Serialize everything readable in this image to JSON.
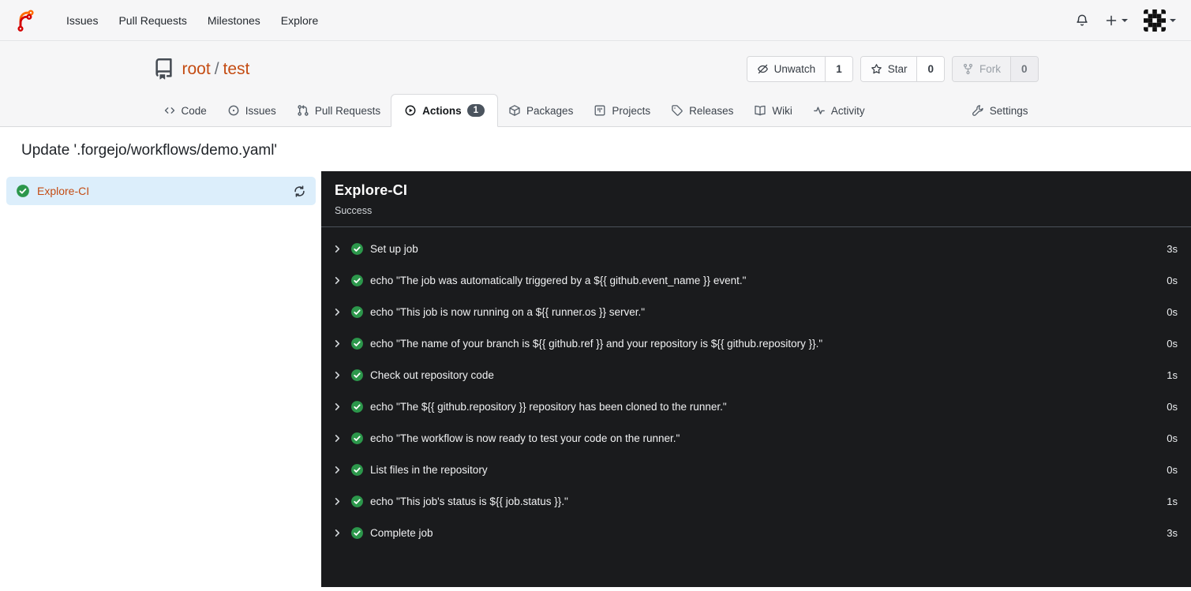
{
  "navbar": {
    "items": [
      {
        "label": "Issues"
      },
      {
        "label": "Pull Requests"
      },
      {
        "label": "Milestones"
      },
      {
        "label": "Explore"
      }
    ]
  },
  "repo_header": {
    "owner": "root",
    "separator": "/",
    "name": "test",
    "watch": {
      "label": "Unwatch",
      "count": "1"
    },
    "star": {
      "label": "Star",
      "count": "0"
    },
    "fork": {
      "label": "Fork",
      "count": "0"
    }
  },
  "tabs": {
    "code": {
      "label": "Code"
    },
    "issues": {
      "label": "Issues"
    },
    "pull_requests": {
      "label": "Pull Requests"
    },
    "actions": {
      "label": "Actions",
      "badge": "1"
    },
    "packages": {
      "label": "Packages"
    },
    "projects": {
      "label": "Projects"
    },
    "releases": {
      "label": "Releases"
    },
    "wiki": {
      "label": "Wiki"
    },
    "activity": {
      "label": "Activity"
    },
    "settings": {
      "label": "Settings"
    }
  },
  "page": {
    "title": "Update '.forgejo/workflows/demo.yaml'"
  },
  "sidebar": {
    "job": {
      "name": "Explore-CI",
      "status": "success"
    }
  },
  "job_panel": {
    "title": "Explore-CI",
    "status": "Success",
    "steps": [
      {
        "name": "Set up job",
        "duration": "3s"
      },
      {
        "name": "echo \"The job was automatically triggered by a ${{ github.event_name }} event.\"",
        "duration": "0s"
      },
      {
        "name": "echo \"This job is now running on a ${{ runner.os }} server.\"",
        "duration": "0s"
      },
      {
        "name": "echo \"The name of your branch is ${{ github.ref }} and your repository is ${{ github.repository }}.\"",
        "duration": "0s"
      },
      {
        "name": "Check out repository code",
        "duration": "1s"
      },
      {
        "name": "echo \"The ${{ github.repository }} repository has been cloned to the runner.\"",
        "duration": "0s"
      },
      {
        "name": "echo \"The workflow is now ready to test your code on the runner.\"",
        "duration": "0s"
      },
      {
        "name": "List files in the repository",
        "duration": "0s"
      },
      {
        "name": "echo \"This job's status is ${{ job.status }}.\"",
        "duration": "1s"
      },
      {
        "name": "Complete job",
        "duration": "3s"
      }
    ]
  },
  "colors": {
    "accent_orange": "#c44c13",
    "success_green": "#2c974b",
    "panel_bg": "#1a1b1d",
    "selected_job_bg": "#dceefb",
    "badge_bg": "#4b545e"
  }
}
